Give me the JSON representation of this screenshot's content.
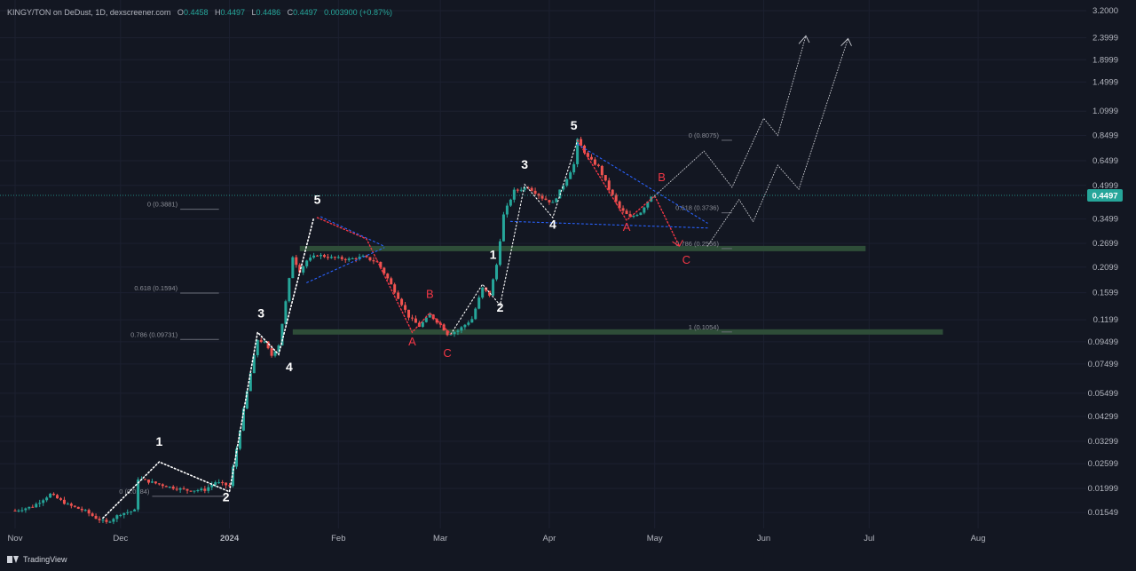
{
  "legend": {
    "pair": "KINGY/TON on DeDust, 1D, dexscreener.com",
    "o_label": "O",
    "o": "0.4458",
    "h_label": "H",
    "h": "0.4497",
    "l_label": "L",
    "l": "0.4486",
    "c_label": "C",
    "c": "0.4497",
    "change": "0.003900 (+0.87%)"
  },
  "branding": {
    "label": "TradingView"
  },
  "colors": {
    "background": "#131722",
    "up": "#26a69a",
    "down": "#ef5350",
    "wave_white": "#ffffff",
    "wave_red": "#f23645",
    "triangle_blue": "#2962ff",
    "zone_green": "#2e4d38",
    "current_price_badge": "#26a69a"
  },
  "chart_data": {
    "type": "candlestick",
    "y_scale": "log",
    "ylim": [
      0.0138,
      3.2
    ],
    "current_price": 0.4497,
    "current_price_label": "0.4497",
    "y_ticks": [
      "3.2000",
      "2.3999",
      "1.8999",
      "1.4999",
      "1.0999",
      "0.8499",
      "0.6499",
      "0.4999",
      "0.3499",
      "0.2699",
      "0.2099",
      "0.1599",
      "0.1199",
      "0.09499",
      "0.07499",
      "0.05499",
      "0.04299",
      "0.03299",
      "0.02599",
      "0.01999",
      "0.01549"
    ],
    "x_ticks": [
      {
        "label": "Nov",
        "date": "2023-11-01"
      },
      {
        "label": "Dec",
        "date": "2023-12-01"
      },
      {
        "label": "2024",
        "date": "2024-01-01"
      },
      {
        "label": "Feb",
        "date": "2024-02-01"
      },
      {
        "label": "Mar",
        "date": "2024-03-01"
      },
      {
        "label": "Apr",
        "date": "2024-04-01"
      },
      {
        "label": "May",
        "date": "2024-05-01"
      },
      {
        "label": "Jun",
        "date": "2024-06-01"
      },
      {
        "label": "Jul",
        "date": "2024-07-01"
      },
      {
        "label": "Aug",
        "date": "2024-08-01"
      }
    ],
    "xlim": [
      "2023-11-01",
      "2024-08-20"
    ],
    "price_path": [
      [
        "2023-11-01",
        0.0158
      ],
      [
        "2023-11-06",
        0.0165
      ],
      [
        "2023-11-11",
        0.0188
      ],
      [
        "2023-11-16",
        0.0168
      ],
      [
        "2023-11-21",
        0.0157
      ],
      [
        "2023-11-24",
        0.0146
      ],
      [
        "2023-11-27",
        0.0139
      ],
      [
        "2023-12-01",
        0.0153
      ],
      [
        "2023-12-05",
        0.0158
      ],
      [
        "2023-12-06",
        0.0222
      ],
      [
        "2023-12-10",
        0.0213
      ],
      [
        "2023-12-15",
        0.0203
      ],
      [
        "2023-12-20",
        0.0196
      ],
      [
        "2023-12-25",
        0.0197
      ],
      [
        "2023-12-28",
        0.0214
      ],
      [
        "2024-01-01",
        0.0205
      ],
      [
        "2024-01-03",
        0.0305
      ],
      [
        "2024-01-05",
        0.046
      ],
      [
        "2024-01-07",
        0.068
      ],
      [
        "2024-01-09",
        0.097
      ],
      [
        "2024-01-11",
        0.094
      ],
      [
        "2024-01-13",
        0.082
      ],
      [
        "2024-01-15",
        0.092
      ],
      [
        "2024-01-17",
        0.145
      ],
      [
        "2024-01-19",
        0.235
      ],
      [
        "2024-01-21",
        0.201
      ],
      [
        "2024-01-23",
        0.225
      ],
      [
        "2024-01-26",
        0.239
      ],
      [
        "2024-01-30",
        0.232
      ],
      [
        "2024-02-04",
        0.228
      ],
      [
        "2024-02-08",
        0.234
      ],
      [
        "2024-02-12",
        0.221
      ],
      [
        "2024-02-15",
        0.186
      ],
      [
        "2024-02-18",
        0.152
      ],
      [
        "2024-02-21",
        0.124
      ],
      [
        "2024-02-24",
        0.112
      ],
      [
        "2024-02-27",
        0.126
      ],
      [
        "2024-03-01",
        0.114
      ],
      [
        "2024-03-03",
        0.103
      ],
      [
        "2024-03-06",
        0.107
      ],
      [
        "2024-03-10",
        0.121
      ],
      [
        "2024-03-13",
        0.168
      ],
      [
        "2024-03-15",
        0.156
      ],
      [
        "2024-03-17",
        0.215
      ],
      [
        "2024-03-19",
        0.365
      ],
      [
        "2024-03-22",
        0.472
      ],
      [
        "2024-03-26",
        0.492
      ],
      [
        "2024-03-30",
        0.438
      ],
      [
        "2024-04-02",
        0.414
      ],
      [
        "2024-04-05",
        0.503
      ],
      [
        "2024-04-08",
        0.625
      ],
      [
        "2024-04-09",
        0.807
      ],
      [
        "2024-04-12",
        0.671
      ],
      [
        "2024-04-15",
        0.609
      ],
      [
        "2024-04-18",
        0.48
      ],
      [
        "2024-04-21",
        0.392
      ],
      [
        "2024-04-24",
        0.355
      ],
      [
        "2024-04-27",
        0.377
      ],
      [
        "2024-04-30",
        0.448
      ],
      [
        "2024-05-01",
        0.4497
      ]
    ],
    "fib_levels": [
      {
        "label": "0 (0.3881)",
        "value": 0.3881
      },
      {
        "label": "0.618 (0.1594)",
        "value": 0.1594
      },
      {
        "label": "0.786 (0.09731)",
        "value": 0.09731
      },
      {
        "label": "0 (0.8075)",
        "value": 0.8075
      },
      {
        "label": "0.618 (0.3736)",
        "value": 0.3736
      },
      {
        "label": "0.786 (0.2556)",
        "value": 0.2556
      },
      {
        "label": "1 (0.1054)",
        "value": 0.1054
      },
      {
        "label": "0 (0.0184)",
        "value": 0.0184
      }
    ],
    "zones": [
      {
        "value": 0.2556,
        "from": "2024-01-21",
        "to": "2024-06-30"
      },
      {
        "value": 0.1054,
        "from": "2024-01-19",
        "to": "2024-07-22"
      }
    ],
    "wave_labels": [
      {
        "text": "1",
        "date": "2023-12-12",
        "value": 0.0315,
        "color": "white"
      },
      {
        "text": "2",
        "date": "2023-12-31",
        "value": 0.0174,
        "color": "white"
      },
      {
        "text": "3",
        "date": "2024-01-10",
        "value": 0.123,
        "color": "white"
      },
      {
        "text": "4",
        "date": "2024-01-18",
        "value": 0.0695,
        "color": "white"
      },
      {
        "text": "5",
        "date": "2024-01-26",
        "value": 0.412,
        "color": "white"
      },
      {
        "text": "A",
        "date": "2024-02-22",
        "value": 0.0915,
        "color": "red"
      },
      {
        "text": "B",
        "date": "2024-02-27",
        "value": 0.151,
        "color": "red"
      },
      {
        "text": "C",
        "date": "2024-03-03",
        "value": 0.0807,
        "color": "red"
      },
      {
        "text": "1",
        "date": "2024-03-16",
        "value": 0.229,
        "color": "white"
      },
      {
        "text": "2",
        "date": "2024-03-18",
        "value": 0.1305,
        "color": "white"
      },
      {
        "text": "3",
        "date": "2024-03-25",
        "value": 0.597,
        "color": "white"
      },
      {
        "text": "4",
        "date": "2024-04-02",
        "value": 0.316,
        "color": "white"
      },
      {
        "text": "5",
        "date": "2024-04-08",
        "value": 0.905,
        "color": "white"
      },
      {
        "text": "A",
        "date": "2024-04-23",
        "value": 0.309,
        "color": "red"
      },
      {
        "text": "B",
        "date": "2024-05-03",
        "value": 0.522,
        "color": "red"
      },
      {
        "text": "C",
        "date": "2024-05-10",
        "value": 0.218,
        "color": "red"
      }
    ]
  }
}
